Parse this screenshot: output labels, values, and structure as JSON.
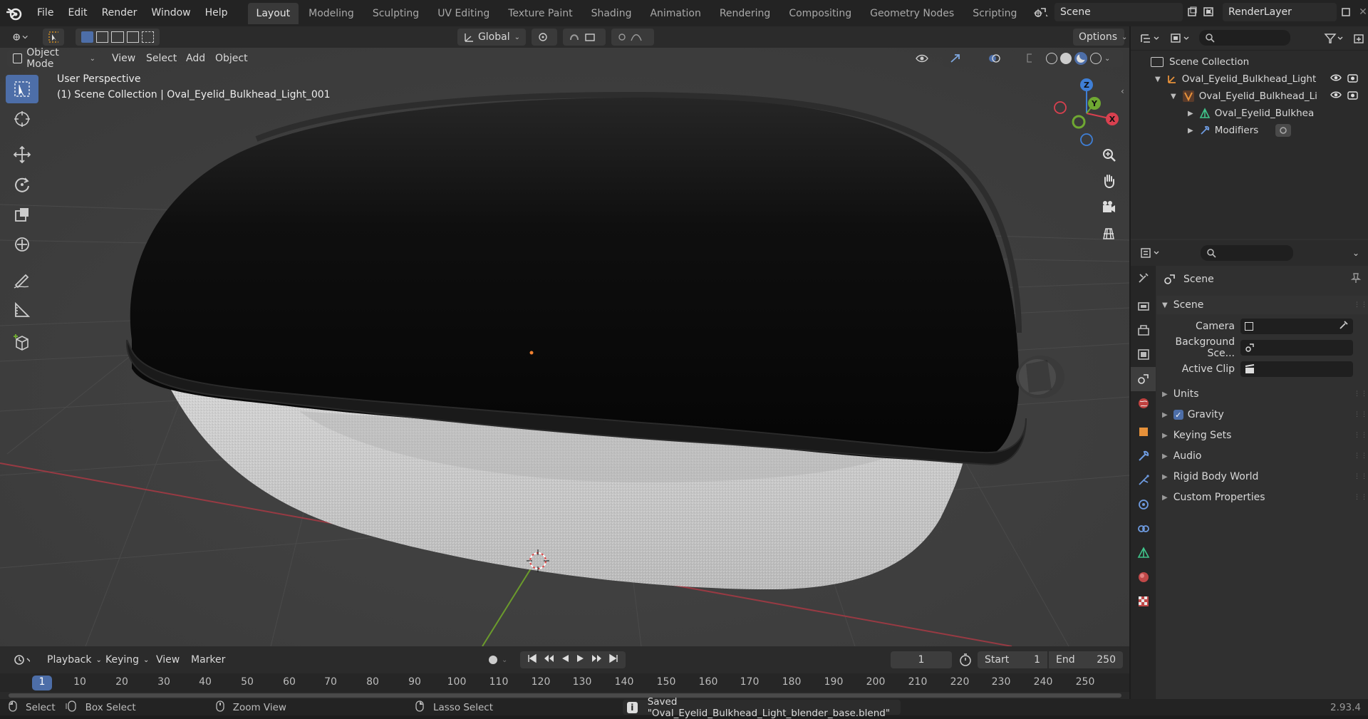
{
  "menu": {
    "items": [
      "File",
      "Edit",
      "Render",
      "Window",
      "Help"
    ]
  },
  "workspaces": {
    "tabs": [
      "Layout",
      "Modeling",
      "Sculpting",
      "UV Editing",
      "Texture Paint",
      "Shading",
      "Animation",
      "Rendering",
      "Compositing",
      "Geometry Nodes",
      "Scripting"
    ],
    "active": "Layout"
  },
  "top_right": {
    "scene": "Scene",
    "render_layer": "RenderLayer"
  },
  "viewport_header": {
    "orientation": "Global",
    "options": "Options",
    "mode": "Object Mode",
    "menus": [
      "View",
      "Select",
      "Add",
      "Object"
    ]
  },
  "viewport": {
    "perspective": "User Perspective",
    "collection_info": "(1) Scene Collection | Oval_Eyelid_Bulkhead_Light_001",
    "gizmo_axes": {
      "x": "X",
      "y": "Y",
      "z": "Z"
    }
  },
  "outliner": {
    "root": "Scene Collection",
    "rows": [
      {
        "label": "Oval_Eyelid_Bulkhead_Light",
        "icon": "empty-axes-icon"
      },
      {
        "label": "Oval_Eyelid_Bulkhead_Li",
        "icon": "object-icon"
      },
      {
        "label": "Oval_Eyelid_Bulkhea",
        "icon": "mesh-data-icon"
      },
      {
        "label": "Modifiers",
        "icon": "wrench-icon"
      }
    ]
  },
  "properties": {
    "context_label": "Scene",
    "panel_title": "Scene",
    "fields": [
      {
        "label": "Camera",
        "value": ""
      },
      {
        "label": "Background Sce...",
        "value": ""
      },
      {
        "label": "Active Clip",
        "value": ""
      }
    ],
    "sections": [
      "Units",
      "Gravity",
      "Keying Sets",
      "Audio",
      "Rigid Body World",
      "Custom Properties"
    ],
    "gravity_checked": true
  },
  "timeline": {
    "menus": [
      "Playback",
      "Keying",
      "View",
      "Marker"
    ],
    "current_frame": "1",
    "start_label": "Start",
    "start": "1",
    "end_label": "End",
    "end": "250",
    "ruler": [
      "1",
      "10",
      "20",
      "30",
      "40",
      "50",
      "60",
      "70",
      "80",
      "90",
      "100",
      "110",
      "120",
      "130",
      "140",
      "150",
      "160",
      "170",
      "180",
      "190",
      "200",
      "210",
      "220",
      "230",
      "240",
      "250"
    ]
  },
  "statusbar": {
    "select": "Select",
    "box_select": "Box Select",
    "zoom_view": "Zoom View",
    "lasso_select": "Lasso Select",
    "message": "Saved \"Oval_Eyelid_Bulkhead_Light_blender_base.blend\"",
    "version": "2.93.4"
  },
  "colors": {
    "accent": "#4d6ea8",
    "x_axis": "#d9404f",
    "y_axis": "#6fa832",
    "z_axis": "#3f7fd6",
    "origin": "#f08030"
  }
}
